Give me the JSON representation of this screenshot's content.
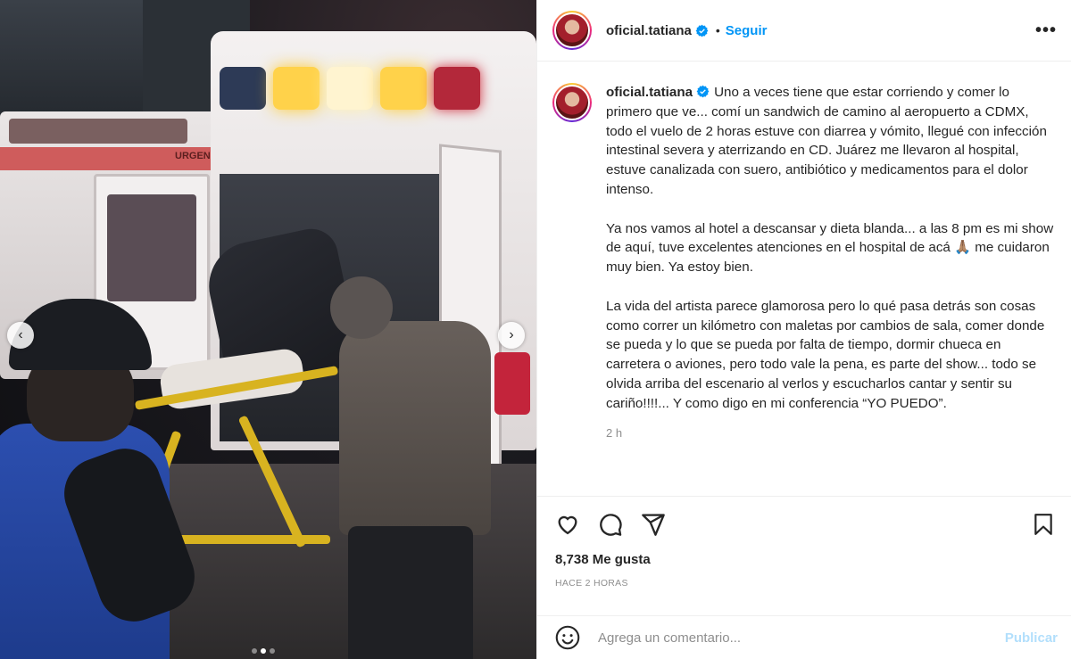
{
  "photo": {
    "prev_glyph": "‹",
    "next_glyph": "›",
    "ambulance_text": "URGENCIAS",
    "carousel": {
      "count": 3,
      "active_index": 1
    }
  },
  "header": {
    "username": "oficial.tatiana",
    "verified_icon": "verified-badge-icon",
    "separator": "•",
    "follow_label": "Seguir",
    "more_icon": "more-options-icon",
    "more_glyph": "•••"
  },
  "caption": {
    "username": "oficial.tatiana",
    "text": "Uno a veces tiene que estar corriendo y comer lo primero que ve... comí un sandwich de camino al aeropuerto a CDMX, todo el vuelo de 2 horas estuve con diarrea y vómito, llegué con infección intestinal severa y aterrizando en CD. Juárez me llevaron al hospital, estuve canalizada con suero, antibiótico y medicamentos para el dolor intenso.\n\nYa nos vamos al hotel a descansar y dieta blanda... a las 8 pm es mi show de aquí, tuve excelentes atenciones en el hospital de acá 🙏🏽 me cuidaron muy bien. Ya estoy bien.\n\nLa vida del artista parece glamorosa pero lo qué pasa detrás son cosas como correr un kilómetro con maletas por cambios de sala, comer donde se pueda y lo que se pueda por falta de tiempo, dormir chueca en carretera o aviones, pero todo vale la pena, es parte del show... todo se olvida arriba del escenario al verlos y escucharlos cantar y sentir su cariño!!!!... Y como digo en mi conferencia “YO PUEDO”.",
    "time": "2 h"
  },
  "actions": {
    "icons": [
      "heart-icon",
      "comment-icon",
      "share-icon",
      "bookmark-icon"
    ]
  },
  "likes": "8,738 Me gusta",
  "posted_ago": "HACE 2 HORAS",
  "comment": {
    "emoji_icon": "emoji-icon",
    "placeholder": "Agrega un comentario...",
    "post_label": "Publicar"
  },
  "colors": {
    "accent": "#0095f6",
    "post_disabled": "#b2dffc",
    "text": "#262626",
    "muted": "#8e8e8e"
  }
}
